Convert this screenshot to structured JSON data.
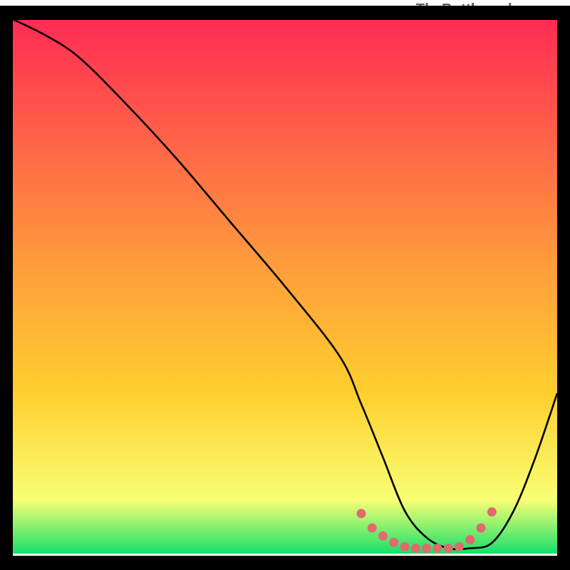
{
  "attribution": "TheBottlenecker.com",
  "colors": {
    "gradient_top": "#ff2b54",
    "gradient_mid": "#ffcf2e",
    "gradient_low": "#f8ff74",
    "gradient_bottom": "#16e06a",
    "curve_stroke": "#000000",
    "dots_fill": "#e06a6e",
    "frame_stroke": "#000000"
  },
  "chart_data": {
    "type": "line",
    "title": "",
    "xlabel": "",
    "ylabel": "",
    "xlim": [
      0,
      100
    ],
    "ylim": [
      0,
      100
    ],
    "series": [
      {
        "name": "bottleneck-curve",
        "x": [
          0,
          6,
          12,
          20,
          30,
          40,
          50,
          60,
          64,
          68,
          72,
          76,
          80,
          84,
          88,
          92,
          96,
          100
        ],
        "y": [
          100,
          97,
          93,
          85,
          74,
          62,
          50,
          37,
          28,
          18,
          8,
          3,
          1,
          1,
          2,
          8,
          18,
          30
        ]
      }
    ],
    "flat_region_dots": {
      "x": [
        64,
        66,
        68,
        70,
        72,
        74,
        76,
        78,
        80,
        82,
        84,
        86,
        88
      ],
      "y": [
        7.5,
        4.8,
        3.3,
        2.1,
        1.3,
        1.0,
        1.0,
        1.0,
        1.0,
        1.3,
        2.6,
        4.8,
        7.8
      ]
    }
  }
}
